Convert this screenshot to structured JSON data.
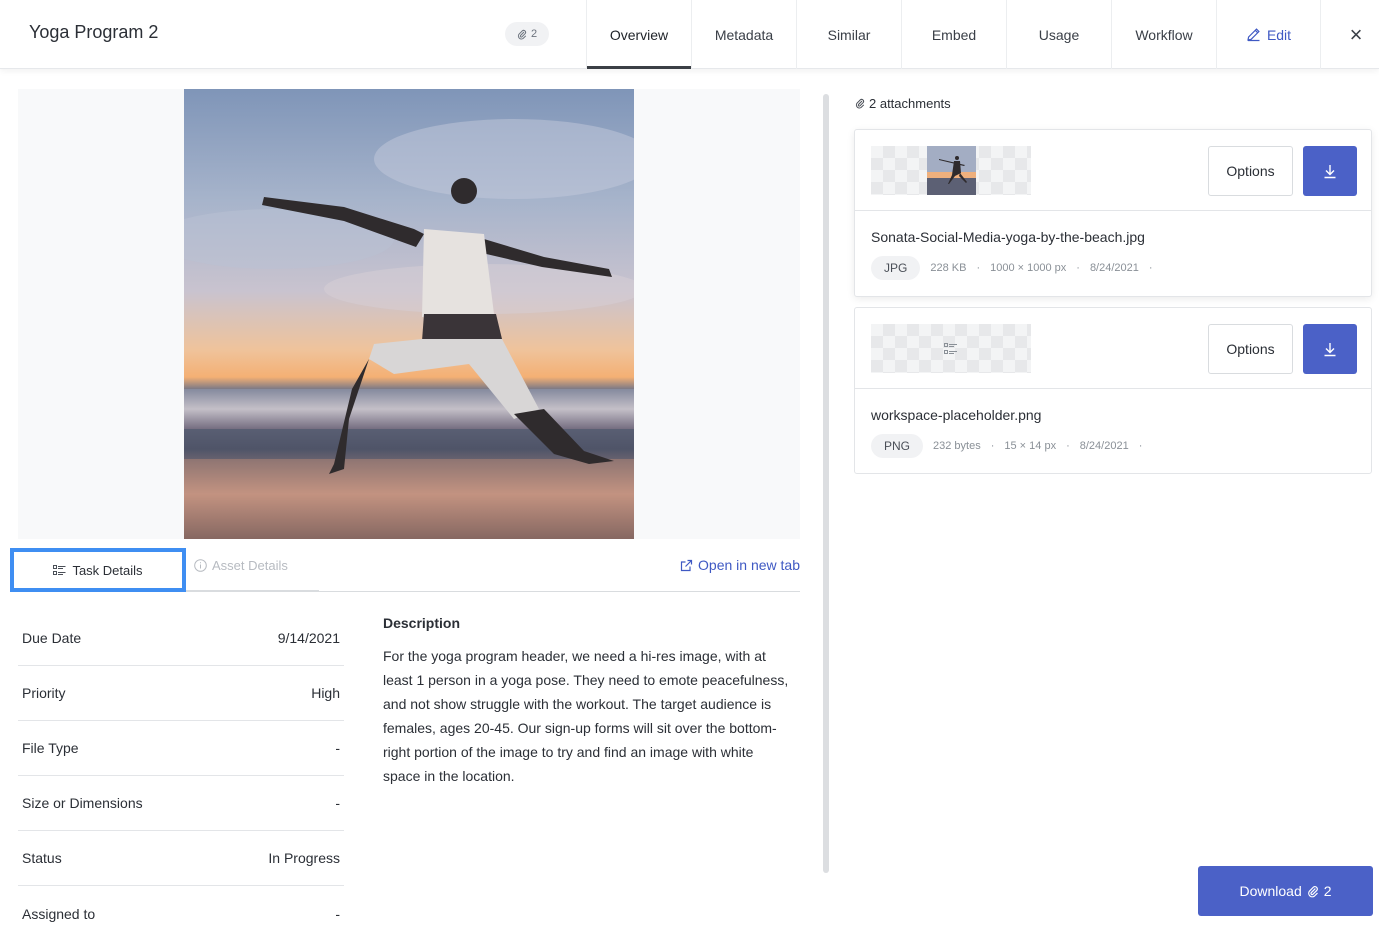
{
  "header": {
    "title": "Yoga Program 2",
    "attachment_pill": "2",
    "tabs": [
      {
        "label": "Overview"
      },
      {
        "label": "Metadata"
      },
      {
        "label": "Similar"
      },
      {
        "label": "Embed"
      },
      {
        "label": "Usage"
      },
      {
        "label": "Workflow"
      }
    ],
    "edit_label": "Edit",
    "close_glyph": "×"
  },
  "detail_tabs": {
    "task": "Task Details",
    "asset": "Asset Details",
    "open_new_tab": "Open in new tab"
  },
  "fields": [
    {
      "label": "Due Date",
      "value": "9/14/2021"
    },
    {
      "label": "Priority",
      "value": "High"
    },
    {
      "label": "File Type",
      "value": "-"
    },
    {
      "label": "Size or Dimensions",
      "value": "-"
    },
    {
      "label": "Status",
      "value": "In Progress"
    },
    {
      "label": "Assigned to",
      "value": "-"
    }
  ],
  "description": {
    "heading": "Description",
    "text": "For the yoga program header, we need a hi-res image, with at least 1 person in a yoga pose. They need to emote peacefulness, and not show struggle with the workout. The target audience is females, ages 20-45. Our sign-up forms will sit over the bottom-right portion of the image to try and find an image with white space in the location."
  },
  "attachments": {
    "count_label": "2 attachments",
    "options_label": "Options",
    "items": [
      {
        "filename": "Sonata-Social-Media-yoga-by-the-beach.jpg",
        "type": "JPG",
        "size": "228 KB",
        "dimensions": "1000 × 1000 px",
        "date": "8/24/2021"
      },
      {
        "filename": "workspace-placeholder.png",
        "type": "PNG",
        "size": "232 bytes",
        "dimensions": "15 × 14 px",
        "date": "8/24/2021"
      }
    ],
    "download_all_label": "Download",
    "download_all_count": "2"
  },
  "colors": {
    "accent": "#4b61c7",
    "link": "#3f59c3",
    "highlight": "#3f8ef2"
  },
  "icons": [
    "paperclip-icon",
    "pencil-icon",
    "close-icon",
    "task-list-icon",
    "info-icon",
    "external-link-icon",
    "download-icon"
  ]
}
